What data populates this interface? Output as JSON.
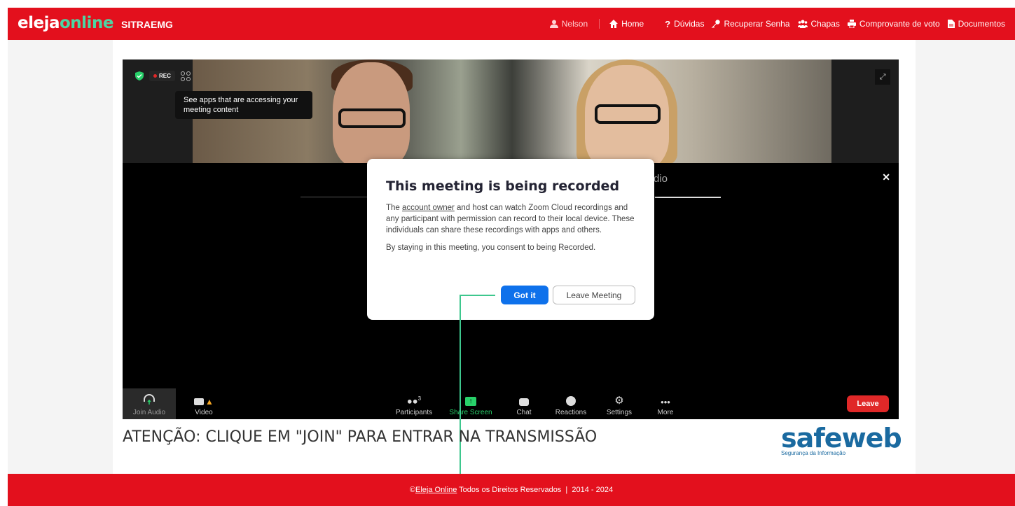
{
  "header": {
    "logo_main": "eleja",
    "logo_accent": "online",
    "org": "SITRAEMG",
    "user": "Nelson",
    "nav": {
      "home": "Home",
      "duvidas": "Dúvidas",
      "recuperar": "Recuperar Senha",
      "chapas": "Chapas",
      "comprovante": "Comprovante de voto",
      "documentos": "Documentos"
    }
  },
  "zoom": {
    "rec_label": "REC",
    "tooltip": "See apps that are accessing your meeting content",
    "ghost_text": "dio",
    "toolbar": {
      "join_audio": "Join Audio",
      "video": "Video",
      "participants": "Participants",
      "participants_count": "3",
      "share_screen": "Share Screen",
      "chat": "Chat",
      "reactions": "Reactions",
      "settings": "Settings",
      "more": "More",
      "leave": "Leave"
    },
    "dialog": {
      "title": "This meeting is being recorded",
      "p1_before": "The ",
      "p1_link": "account owner",
      "p1_after": " and host can watch Zoom Cloud recordings and any participant with permission can record to their local device. These individuals can share these recordings with apps and others.",
      "p2": "By staying in this meeting, you consent to being Recorded.",
      "got_it": "Got it",
      "leave_meeting": "Leave Meeting"
    }
  },
  "attention": "ATENÇÃO: CLIQUE EM \"JOIN\" PARA ENTRAR NA TRANSMISSÃO",
  "sponsor": {
    "name": "safeweb",
    "tagline": "Segurança da Informação"
  },
  "footer": {
    "copyright_sign": "©",
    "link": "Eleja Online",
    "text": " Todos os Direitos Reservados  |  2014 - 2024"
  },
  "colors": {
    "brand_red": "#e3101d",
    "zoom_blue": "#0e71eb",
    "share_green": "#28d16a",
    "leave_red": "#e02828"
  }
}
